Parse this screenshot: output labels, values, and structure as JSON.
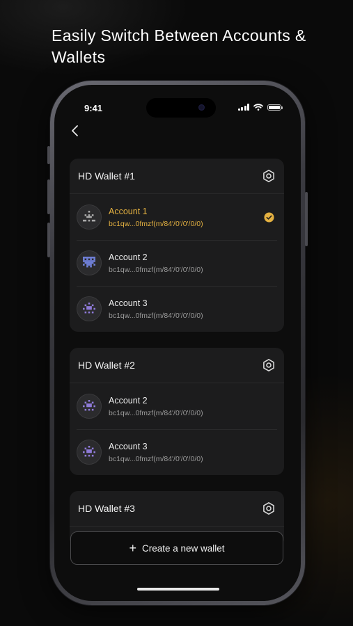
{
  "headline": "Easily Switch Between Accounts & Wallets",
  "status_bar": {
    "time": "9:41",
    "icons": [
      "signal-icon",
      "wifi-icon",
      "battery-icon"
    ]
  },
  "nav": {
    "back_icon": "chevron-left-icon"
  },
  "accent_color": "#e3b041",
  "wallets": [
    {
      "title": "HD Wallet #1",
      "settings_icon": "gear-icon",
      "accounts": [
        {
          "name": "Account 1",
          "address": "bc1qw...0fmzf(m/84'/0'/0'/0/0)",
          "selected": true
        },
        {
          "name": "Account 2",
          "address": "bc1qw...0fmzf(m/84'/0'/0'/0/0)",
          "selected": false
        },
        {
          "name": "Account 3",
          "address": "bc1qw...0fmzf(m/84'/0'/0'/0/0)",
          "selected": false
        }
      ]
    },
    {
      "title": "HD Wallet #2",
      "settings_icon": "gear-icon",
      "accounts": [
        {
          "name": "Account 2",
          "address": "bc1qw...0fmzf(m/84'/0'/0'/0/0)",
          "selected": false
        },
        {
          "name": "Account 3",
          "address": "bc1qw...0fmzf(m/84'/0'/0'/0/0)",
          "selected": false
        }
      ]
    },
    {
      "title": "HD Wallet #3",
      "settings_icon": "gear-icon",
      "accounts": []
    }
  ],
  "create_button": {
    "icon": "plus-icon",
    "plus_glyph": "+",
    "label": "Create a new wallet"
  }
}
